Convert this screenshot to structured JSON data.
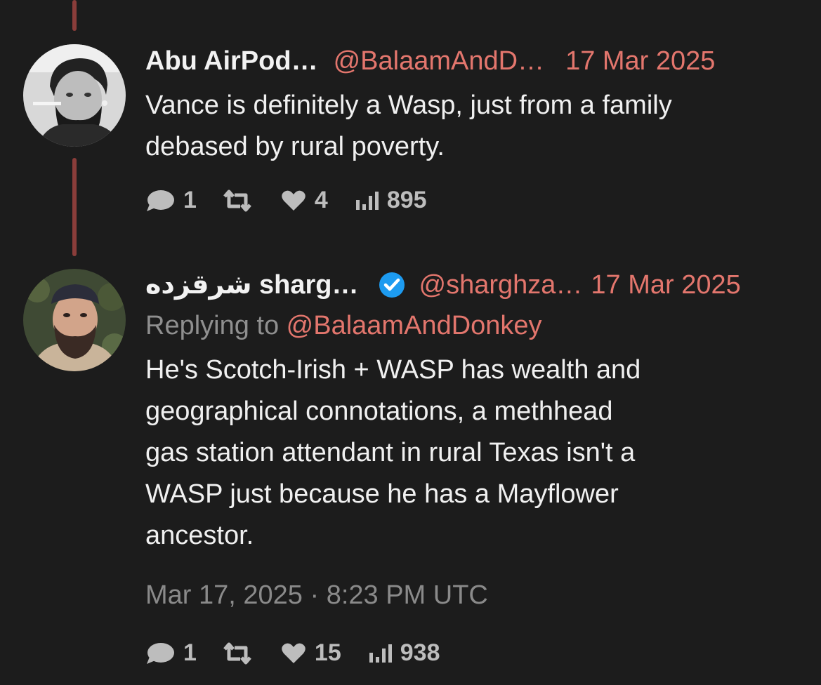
{
  "tweet1": {
    "name": "Abu AirPod…",
    "handle": "@BalaamAndD…",
    "date": "17 Mar 2025",
    "text_line1": "Vance is definitely a Wasp, just from a family",
    "text_line2": "debased by rural poverty.",
    "stats": {
      "replies": "1",
      "likes": "4",
      "views": "895"
    }
  },
  "tweet2": {
    "name": "شرقزده sharg…",
    "handle": "@sharghza…",
    "date": "17 Mar 2025",
    "replying_prefix": "Replying to ",
    "replying_handle": "@BalaamAndDonkey",
    "text_lines": [
      "He's Scotch-Irish + WASP has wealth and",
      "geographical connotations, a methhead",
      "gas station attendant in rural Texas isn't a",
      "WASP just because he has a Mayflower",
      "ancestor."
    ],
    "timestamp": "Mar 17, 2025 · 8:23 PM UTC",
    "stats": {
      "replies": "1",
      "likes": "15",
      "views": "938"
    }
  },
  "colors": {
    "background": "#1c1c1c",
    "accent": "#e3766d",
    "thread_line": "#8a3d3a",
    "verified": "#1d9bf0"
  },
  "icons": [
    "reply-bubble-icon",
    "retweet-icon",
    "heart-icon",
    "views-bar-icon",
    "verified-badge-icon"
  ]
}
